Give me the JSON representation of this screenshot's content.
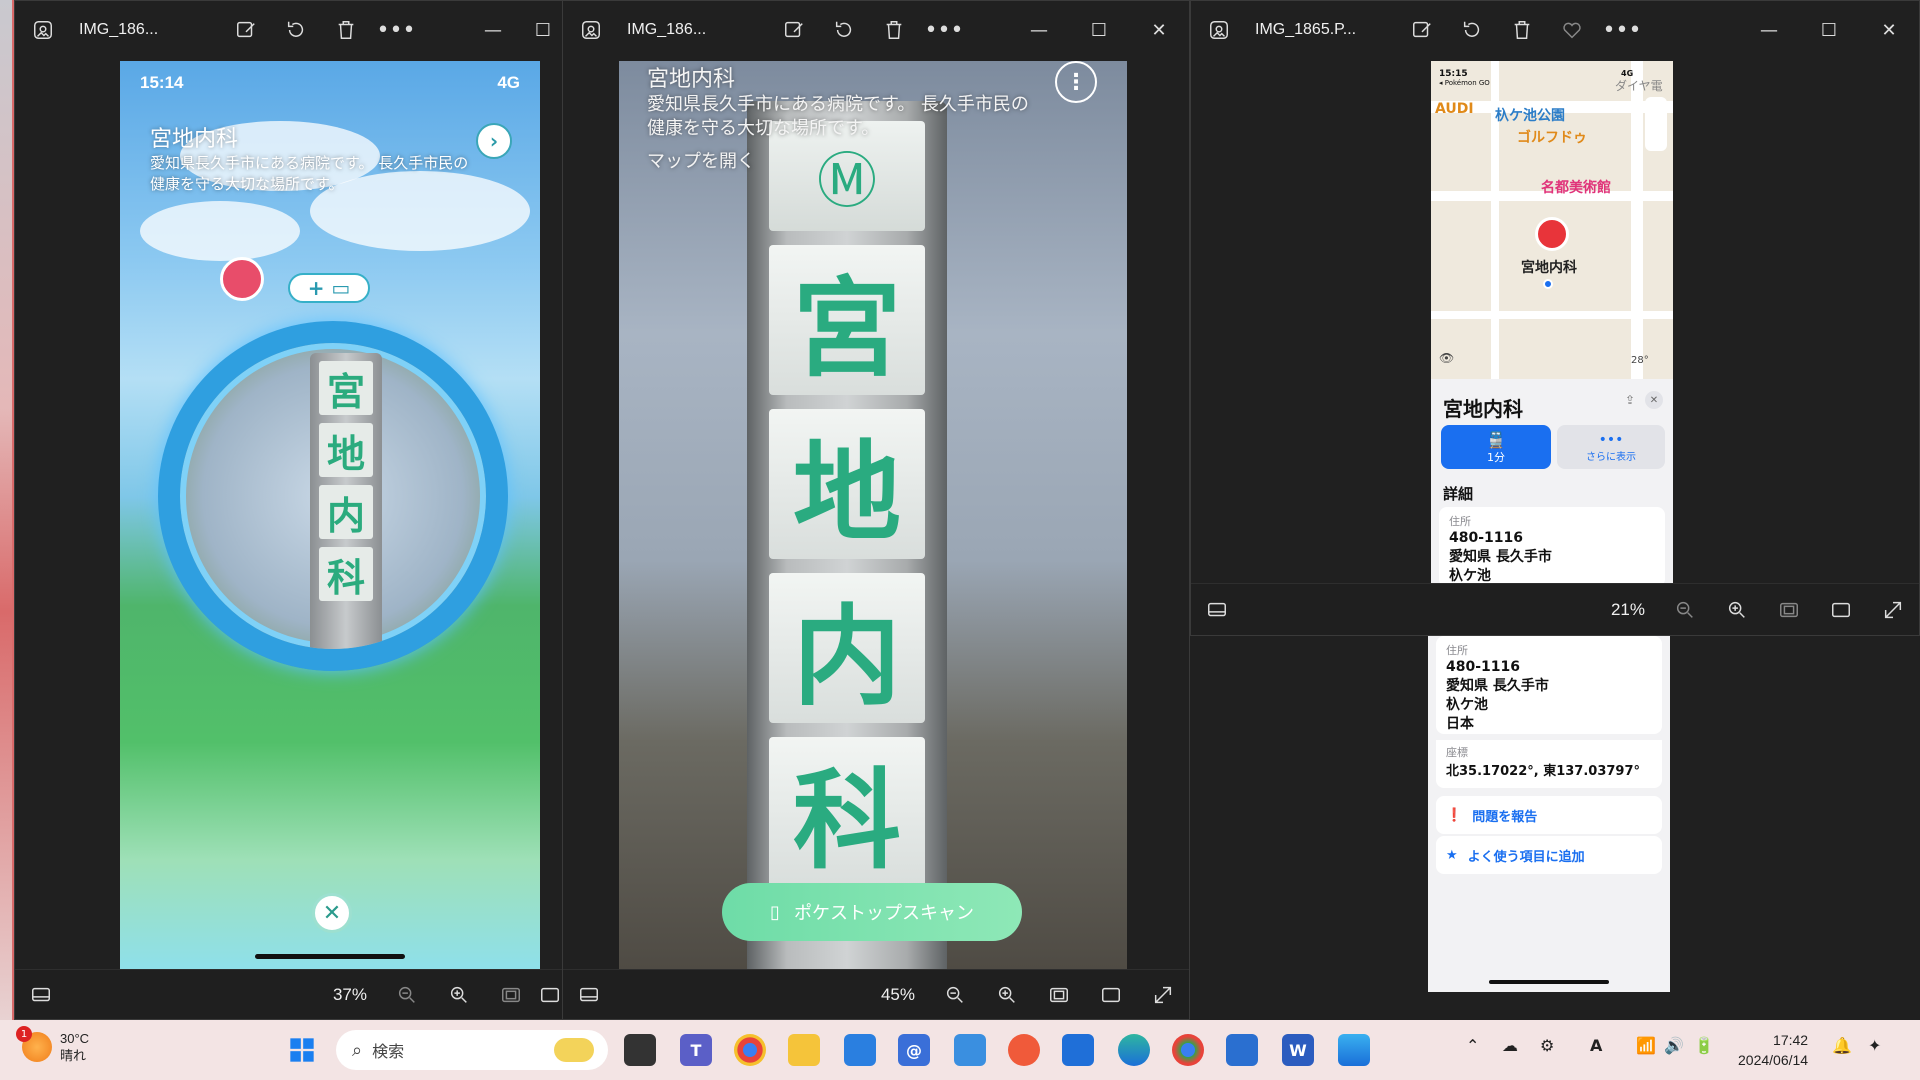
{
  "windows": [
    {
      "title": "IMG_186...",
      "zoom": "37%",
      "phone": {
        "time": "15:14",
        "signal": "4G",
        "place_name": "宮地内科",
        "place_desc": "愛知県長久手市にある病院です。 長久手市民の健康を守る大切な場所です。",
        "pillar_chars": [
          "宮",
          "地",
          "内",
          "科"
        ]
      }
    },
    {
      "title": "IMG_186...",
      "zoom": "45%",
      "phone": {
        "place_name": "宮地内科",
        "place_desc": "愛知県長久手市にある病院です。 長久手市民の健康を守る大切な場所です。",
        "open_map": "マップを開く",
        "pillar_chars": [
          "宮",
          "地",
          "内",
          "科"
        ],
        "scan_button": "ポケストップスキャン"
      }
    },
    {
      "title": "IMG_1865.P...",
      "zoom": "21%",
      "phone": {
        "time": "15:15",
        "back_app": "◂ Pokémon GO",
        "signal": "4G",
        "map_labels": {
          "park": "杁ケ池公園",
          "golf": "ゴルフドゥ",
          "museum": "名都美術館",
          "audi": "AUDI",
          "diamond": "ダイヤ電",
          "pin_label": "宮地内科",
          "temp": "28°"
        },
        "sheet_title": "宮地内科",
        "transit_time": "1分",
        "more_label": "さらに表示",
        "details_header": "詳細",
        "address_label": "住所",
        "address_lines": [
          "480-1116",
          "愛知県 長久手市",
          "杁ケ池"
        ]
      }
    }
  ],
  "lower_panel": {
    "address_label": "住所",
    "address_lines": [
      "480-1116",
      "愛知県 長久手市",
      "杁ケ池",
      "日本"
    ],
    "coords_label": "座標",
    "coords_value": "北35.17022°, 東137.03797°",
    "report": "問題を報告",
    "favorite": "よく使う項目に追加",
    "zoom": "21%"
  },
  "taskbar": {
    "weather_temp": "30°C",
    "weather_cond": "晴れ",
    "weather_badge": "1",
    "search_placeholder": "検索",
    "time": "17:42",
    "date": "2024/06/14"
  },
  "colors": {
    "accent_blue": "#1a6ff0",
    "pokemon_green": "#2aab80",
    "window_bg": "#202020",
    "taskbar_bg": "#f3e4e4"
  }
}
